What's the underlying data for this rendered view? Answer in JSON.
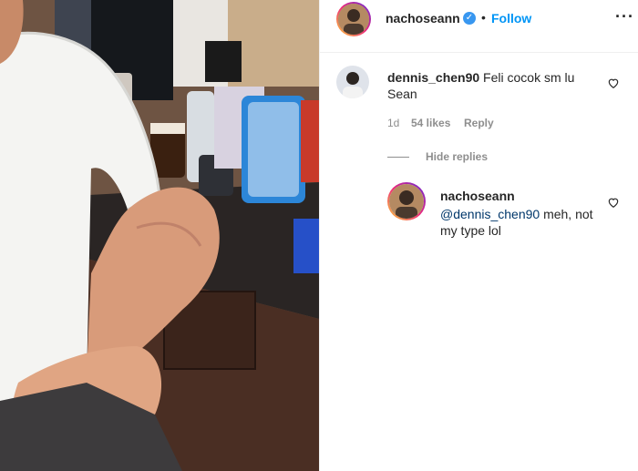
{
  "post": {
    "author": "nachoseann",
    "follow_label": "Follow",
    "separator": "•",
    "more_label": "···"
  },
  "comments": [
    {
      "username": "dennis_chen90",
      "text": "Feli cocok sm lu Sean",
      "time": "1d",
      "likes": "54 likes",
      "reply_label": "Reply",
      "hide_replies_label": "Hide replies"
    }
  ],
  "reply": {
    "username": "nachoseann",
    "mention": "@dennis_chen90",
    "text": " meh, not my type lol"
  },
  "colors": {
    "link": "#0095f6",
    "secondary": "#8e8e8e",
    "verified": "#3897f0"
  }
}
